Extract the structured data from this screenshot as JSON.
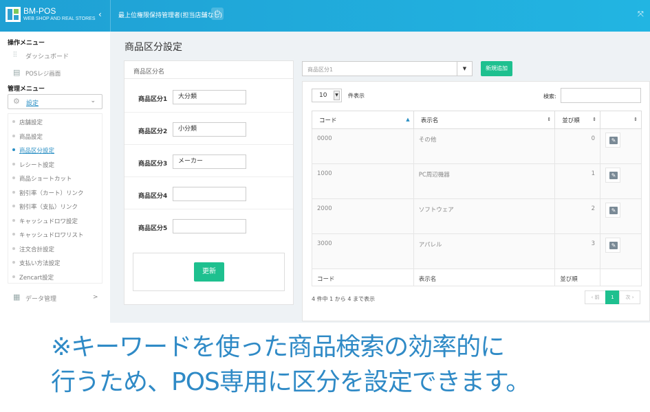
{
  "header": {
    "brand_title": "BM-POS",
    "brand_sub": "WEB SHOP AND REAL STORES",
    "collapse": "‹",
    "user": "最上位権限保持管理者(担当店舗なし)",
    "power": "⏻",
    "expand": "⤧"
  },
  "sidebar": {
    "sec1": "操作メニュー",
    "dashboard": "ダッシュボード",
    "pos": "POSレジ画面",
    "sec2": "管理メニュー",
    "settings": "設定",
    "submenu": [
      "店舗設定",
      "商品設定",
      "商品区分設定",
      "レシート設定",
      "商品ショートカット",
      "割引率（カート）リンク",
      "割引率（支払）リンク",
      "キャッシュドロワ設定",
      "キャッシュドロワリスト",
      "注文合計設定",
      "支払い方法設定",
      "Zencart設定"
    ],
    "data_mgmt": "データ管理",
    "data_chev": ">"
  },
  "page": {
    "title": "商品区分設定"
  },
  "form": {
    "heading": "商品区分名",
    "rows": [
      {
        "label": "商品区分1",
        "value": "大分類"
      },
      {
        "label": "商品区分2",
        "value": "小分類"
      },
      {
        "label": "商品区分3",
        "value": "メーカー"
      },
      {
        "label": "商品区分4",
        "value": ""
      },
      {
        "label": "商品区分5",
        "value": ""
      }
    ],
    "update": "更新"
  },
  "toolbar": {
    "select_value": "商品区分1",
    "new_button": "新規追加"
  },
  "table": {
    "length": "10",
    "length_suffix": "件表示",
    "search_label": "検索:",
    "headers": [
      "コード",
      "表示名",
      "並び順",
      ""
    ],
    "rows": [
      {
        "code": "0000",
        "name": "その他",
        "order": "0"
      },
      {
        "code": "1000",
        "name": "PC周辺機器",
        "order": "1"
      },
      {
        "code": "2000",
        "name": "ソフトウェア",
        "order": "2"
      },
      {
        "code": "3000",
        "name": "アパレル",
        "order": "3"
      }
    ],
    "footers": [
      "コード",
      "表示名",
      "並び順",
      ""
    ],
    "info": "4 件中 1 から 4 まで表示",
    "pager": {
      "prev": "‹ 前",
      "page": "1",
      "next": "次 ›"
    }
  },
  "caption": {
    "line1": "※キーワードを使った商品検索の効率的に",
    "line2": "行うため、POS専用に区分を設定できます。"
  },
  "colors": {
    "accent": "#1fa0d4",
    "button": "#1ec08f",
    "caption": "#2f8ac6"
  }
}
